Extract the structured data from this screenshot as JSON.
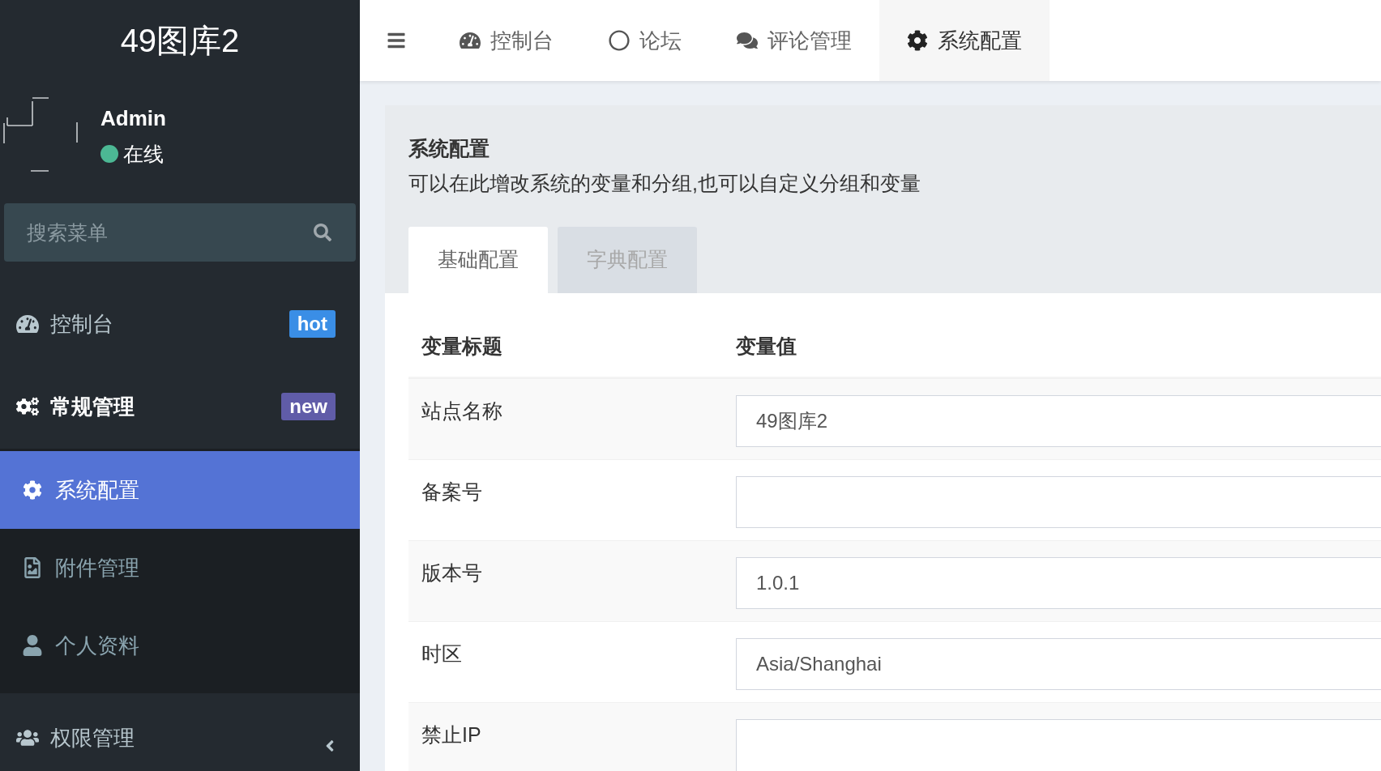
{
  "brand": {
    "title": "49图库2"
  },
  "user": {
    "name": "Admin",
    "online": true,
    "status": "在线"
  },
  "search": {
    "placeholder": "搜索菜单"
  },
  "menu": [
    {
      "label": "控制台",
      "selected": false,
      "badge": {
        "text": "hot",
        "color": "#3a8ee6"
      }
    },
    {
      "label": "常规管理",
      "selected": false,
      "expanded": true,
      "badge": {
        "text": "new",
        "color": "#605ca8"
      },
      "children": [
        {
          "label": "系统配置",
          "selected": true
        },
        {
          "label": "附件管理",
          "selected": false
        },
        {
          "label": "个人资料",
          "selected": false
        }
      ]
    },
    {
      "label": "权限管理",
      "selected": false,
      "expanded": false
    }
  ],
  "navbar": {
    "tabs": [
      {
        "label": "控制台",
        "selected": false
      },
      {
        "label": "论坛",
        "selected": false
      },
      {
        "label": "评论管理",
        "selected": false
      },
      {
        "label": "系统配置",
        "selected": true
      }
    ]
  },
  "panel": {
    "title": "系统配置",
    "description": "可以在此增改系统的变量和分组,也可以自定义分组和变量",
    "tabs": [
      {
        "label": "基础配置",
        "selected": true
      },
      {
        "label": "字典配置",
        "selected": false
      }
    ],
    "table": {
      "columns": [
        "变量标题",
        "变量值"
      ],
      "rows": [
        {
          "label": "站点名称",
          "kind": "input",
          "value": "49图库2"
        },
        {
          "label": "备案号",
          "kind": "input"
        },
        {
          "label": "版本号",
          "kind": "input",
          "value": "1.0.1"
        },
        {
          "label": "时区",
          "kind": "input",
          "value": "Asia/Shanghai"
        },
        {
          "label": "禁止IP",
          "kind": "textarea"
        }
      ]
    }
  }
}
